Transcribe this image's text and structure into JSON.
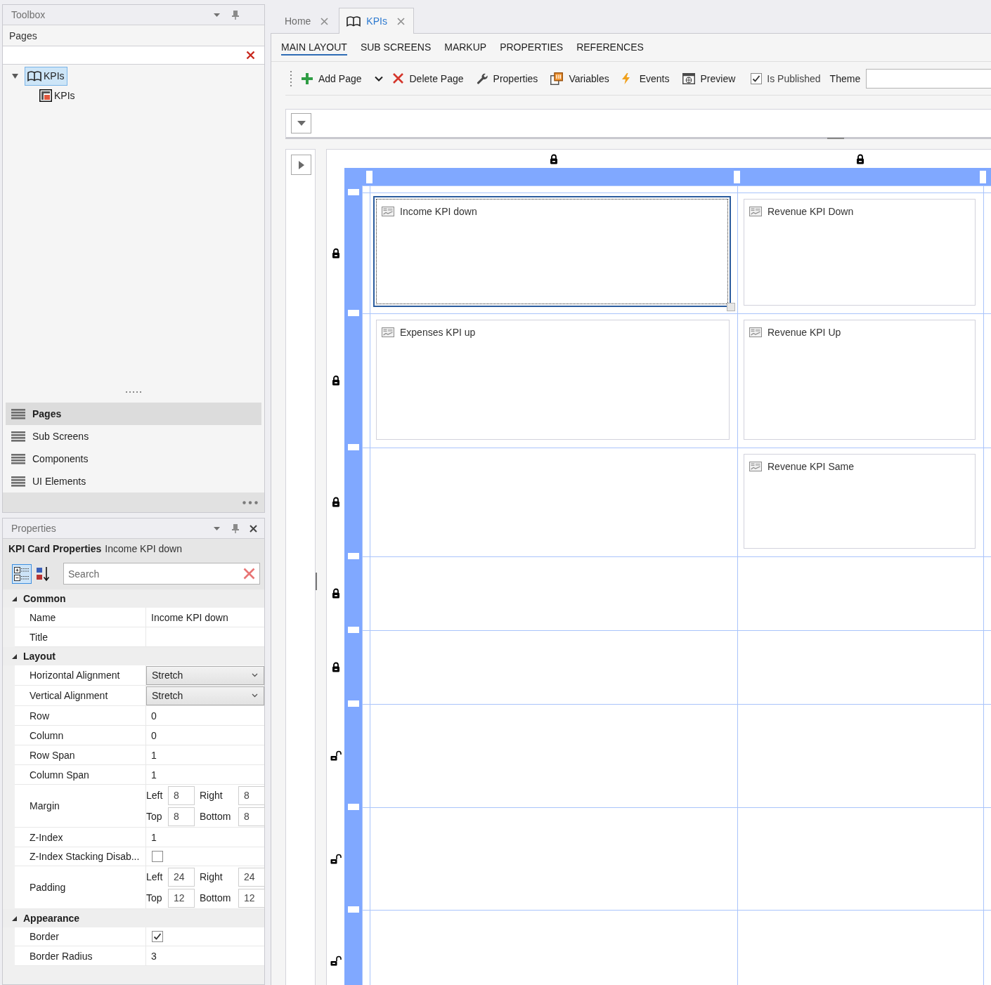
{
  "toolbox": {
    "title": "Toolbox",
    "closable": false,
    "section_title": "Pages",
    "tree": [
      {
        "label": "KPIs",
        "kind": "group",
        "expanded": true,
        "selected": true,
        "children": [
          {
            "label": "KPIs",
            "kind": "page",
            "selected": false
          }
        ]
      }
    ],
    "nav": [
      {
        "label": "Pages",
        "selected": true
      },
      {
        "label": "Sub Screens",
        "selected": false
      },
      {
        "label": "Components",
        "selected": false
      },
      {
        "label": "UI Elements",
        "selected": false
      }
    ]
  },
  "properties": {
    "title": "Properties",
    "closable": true,
    "object_type": "KPI Card Properties",
    "object_name": "Income KPI down",
    "view_modes": [
      {
        "kind": "categorized",
        "selected": true
      },
      {
        "kind": "alphabetical",
        "selected": false
      }
    ],
    "search": {
      "placeholder": "Search"
    },
    "categories": [
      {
        "name": "Common",
        "expanded": true,
        "items": [
          {
            "label": "Name",
            "kind": "text",
            "value": "Income KPI down"
          },
          {
            "label": "Title",
            "kind": "text"
          }
        ]
      },
      {
        "name": "Layout",
        "expanded": true,
        "items": [
          {
            "label": "Horizontal Alignment",
            "kind": "dropdown",
            "value": "Stretch"
          },
          {
            "label": "Vertical Alignment",
            "kind": "dropdown",
            "value": "Stretch"
          },
          {
            "label": "Row",
            "kind": "text",
            "value": "0"
          },
          {
            "label": "Column",
            "kind": "text",
            "value": "0"
          },
          {
            "label": "Row Span",
            "kind": "text",
            "value": "1"
          },
          {
            "label": "Column Span",
            "kind": "text",
            "value": "1"
          },
          {
            "label": "Margin",
            "kind": "sides",
            "sides": [
              {
                "label": "Left",
                "value": "8"
              },
              {
                "label": "Right",
                "value": "8"
              },
              {
                "label": "Top",
                "value": "8"
              },
              {
                "label": "Bottom",
                "value": "8"
              }
            ]
          },
          {
            "label": "Z-Index",
            "kind": "text",
            "value": "1"
          },
          {
            "label": "Z-Index Stacking Disab...",
            "kind": "checkbox",
            "checked": false
          },
          {
            "label": "Padding",
            "kind": "sides",
            "sides": [
              {
                "label": "Left",
                "value": "24"
              },
              {
                "label": "Right",
                "value": "24"
              },
              {
                "label": "Top",
                "value": "12"
              },
              {
                "label": "Bottom",
                "value": "12"
              }
            ]
          }
        ]
      },
      {
        "name": "Appearance",
        "expanded": true,
        "items": [
          {
            "label": "Border",
            "kind": "checkbox",
            "checked": true
          },
          {
            "label": "Border Radius",
            "kind": "text",
            "value": "3"
          }
        ]
      }
    ]
  },
  "document_tabs": [
    {
      "label": "Home",
      "selected": false,
      "has_icon": false
    },
    {
      "label": "KPIs",
      "selected": true,
      "has_icon": true
    }
  ],
  "view_tabs": [
    {
      "label": "MAIN LAYOUT",
      "selected": true
    },
    {
      "label": "SUB SCREENS",
      "selected": false
    },
    {
      "label": "MARKUP",
      "selected": false
    },
    {
      "label": "PROPERTIES",
      "selected": false
    },
    {
      "label": "REFERENCES",
      "selected": false
    }
  ],
  "toolbar": [
    {
      "kind": "add",
      "label": "Add Page"
    },
    {
      "kind": "dropdown"
    },
    {
      "kind": "delete",
      "label": "Delete Page"
    },
    {
      "kind": "properties",
      "label": "Properties"
    },
    {
      "kind": "variables",
      "label": "Variables"
    },
    {
      "kind": "events",
      "label": "Events"
    },
    {
      "kind": "preview",
      "label": "Preview"
    },
    {
      "kind": "checkbox",
      "label": "Is Published",
      "checked": true
    },
    {
      "kind": "label",
      "label": "Theme"
    },
    {
      "kind": "field"
    }
  ],
  "designer": {
    "columns": [
      {
        "locked": true
      },
      {
        "locked": true
      }
    ],
    "rows": [
      {
        "locked": true,
        "cells": [
          {
            "kind": "card",
            "title": "Income KPI down",
            "selected": true
          },
          {
            "kind": "card",
            "title": "Revenue KPI Down",
            "selected": false
          }
        ]
      },
      {
        "locked": true,
        "cells": [
          {
            "kind": "card",
            "title": "Expenses KPI up",
            "selected": false
          },
          {
            "kind": "card",
            "title": "Revenue KPI Up",
            "selected": false
          }
        ]
      },
      {
        "locked": true,
        "cells": [
          {
            "kind": "empty"
          },
          {
            "kind": "card",
            "title": "Revenue KPI Same",
            "selected": false
          }
        ]
      },
      {
        "locked": true
      },
      {
        "locked": true
      },
      {
        "locked": false
      },
      {
        "locked": false
      },
      {
        "locked": false
      }
    ]
  }
}
